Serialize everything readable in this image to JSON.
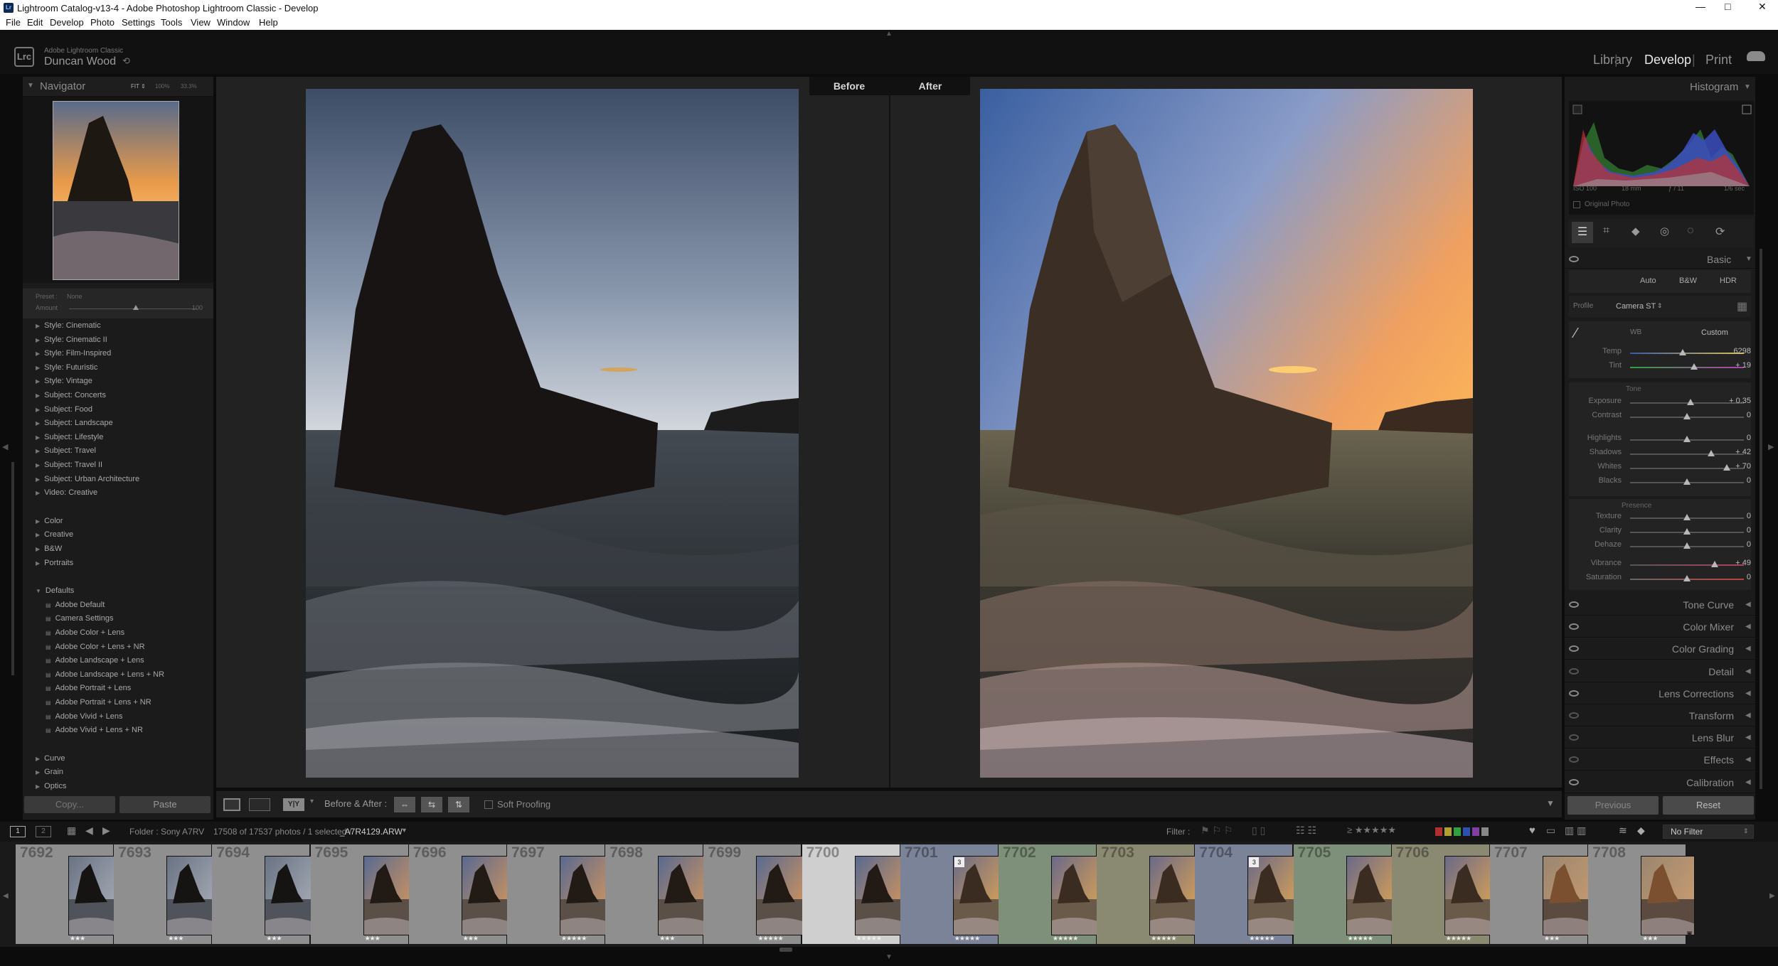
{
  "window": {
    "title": "Lightroom Catalog-v13-4 - Adobe Photoshop Lightroom Classic - Develop",
    "minimize": "—",
    "maximize": "□",
    "close": "✕"
  },
  "menu": [
    "File",
    "Edit",
    "Develop",
    "Photo",
    "Settings",
    "Tools",
    "View",
    "Window",
    "Help"
  ],
  "identity": {
    "app_name": "Adobe Lightroom Classic",
    "user": "Duncan Wood",
    "badge": "Lrc"
  },
  "modules": [
    "Library",
    "Develop",
    "Print"
  ],
  "navigator": {
    "title": "Navigator",
    "zoom_options": [
      "FIT ⇕",
      "100%",
      "33.3%"
    ]
  },
  "presets": {
    "preset_label": "Preset :",
    "preset_value": "None",
    "amount_label": "Amount",
    "amount_value": "100",
    "amount_fraction": 0.52,
    "groups": [
      "Style: Cinematic",
      "Style: Cinematic II",
      "Style: Film-Inspired",
      "Style: Futuristic",
      "Style: Vintage",
      "Subject: Concerts",
      "Subject: Food",
      "Subject: Landscape",
      "Subject: Lifestyle",
      "Subject: Travel",
      "Subject: Travel II",
      "Subject: Urban Architecture",
      "Video: Creative"
    ],
    "groups2": [
      "Color",
      "Creative",
      "B&W",
      "Portraits"
    ],
    "defaults_label": "Defaults",
    "defaults": [
      "Adobe Default",
      "Camera Settings",
      "Adobe Color + Lens",
      "Adobe Color + Lens + NR",
      "Adobe Landscape + Lens",
      "Adobe Landscape + Lens + NR",
      "Adobe Portrait + Lens",
      "Adobe Portrait + Lens + NR",
      "Adobe Vivid + Lens",
      "Adobe Vivid + Lens + NR"
    ],
    "groups3": [
      "Curve",
      "Grain",
      "Optics"
    ]
  },
  "left_buttons": {
    "copy": "Copy...",
    "paste": "Paste"
  },
  "compare": {
    "before_label": "Before",
    "after_label": "After"
  },
  "toolbar": {
    "before_after_label": "Before & After :",
    "soft_proofing": "Soft Proofing",
    "yy": "Y|Y"
  },
  "histogram": {
    "title": "Histogram",
    "iso": "ISO 100",
    "focal": "18 mm",
    "aperture": "ƒ / 11",
    "shutter": "1/6 sec",
    "original_photo": "Original Photo"
  },
  "basic": {
    "title": "Basic",
    "treatments": [
      "Auto",
      "B&W",
      "HDR"
    ],
    "profile_label": "Profile",
    "profile_value": "Camera ST",
    "wb_label": "WB",
    "wb_value": "Custom",
    "tone_label": "Tone",
    "presence_label": "Presence",
    "sliders": [
      {
        "label": "Temp",
        "value": "6298",
        "pos": 0.46,
        "group": "wb"
      },
      {
        "label": "Tint",
        "value": "+ 19",
        "pos": 0.56,
        "group": "wb"
      },
      {
        "label": "Exposure",
        "value": "+ 0.35",
        "pos": 0.53,
        "group": "tone"
      },
      {
        "label": "Contrast",
        "value": "0",
        "pos": 0.5,
        "group": "tone"
      },
      {
        "label": "Highlights",
        "value": "0",
        "pos": 0.5,
        "group": "tone2"
      },
      {
        "label": "Shadows",
        "value": "+ 42",
        "pos": 0.71,
        "group": "tone2"
      },
      {
        "label": "Whites",
        "value": "+ 70",
        "pos": 0.85,
        "group": "tone2"
      },
      {
        "label": "Blacks",
        "value": "0",
        "pos": 0.5,
        "group": "tone2"
      },
      {
        "label": "Texture",
        "value": "0",
        "pos": 0.5,
        "group": "presence"
      },
      {
        "label": "Clarity",
        "value": "0",
        "pos": 0.5,
        "group": "presence"
      },
      {
        "label": "Dehaze",
        "value": "0",
        "pos": 0.5,
        "group": "presence"
      },
      {
        "label": "Vibrance",
        "value": "+ 49",
        "pos": 0.745,
        "group": "presence2"
      },
      {
        "label": "Saturation",
        "value": "0",
        "pos": 0.5,
        "group": "presence2"
      }
    ]
  },
  "right_sections": [
    "Tone Curve",
    "Color Mixer",
    "Color Grading",
    "Detail",
    "Lens Corrections",
    "Transform",
    "Lens Blur",
    "Effects",
    "Calibration"
  ],
  "right_buttons": {
    "previous": "Previous",
    "reset": "Reset"
  },
  "filmstrip_bar": {
    "folder": "Folder : Sony A7RV",
    "count": "17508 of 17537 photos / 1 selected /",
    "filename": "_A7R4129.ARW",
    "filter_label": "Filter :",
    "no_filter": "No Filter",
    "view_nums": [
      "1",
      "2"
    ]
  },
  "filmstrip": [
    {
      "num": "7692",
      "stars": "★★★",
      "tone": "dark",
      "bg": "#8f8f8f"
    },
    {
      "num": "7693",
      "stars": "★★★",
      "tone": "dark",
      "bg": "#8f8f8f"
    },
    {
      "num": "7694",
      "stars": "★★★",
      "tone": "dark",
      "bg": "#8f8f8f"
    },
    {
      "num": "7695",
      "stars": "★★★",
      "tone": "warm",
      "bg": "#8f8f8f"
    },
    {
      "num": "7696",
      "stars": "★★★",
      "tone": "warm",
      "bg": "#8f8f8f"
    },
    {
      "num": "7697",
      "stars": "★★★★★",
      "tone": "warm",
      "bg": "#8f8f8f"
    },
    {
      "num": "7698",
      "stars": "★★★",
      "tone": "warm",
      "bg": "#8f8f8f"
    },
    {
      "num": "7699",
      "stars": "★★★★★",
      "tone": "warm",
      "bg": "#8f8f8f"
    },
    {
      "num": "7700",
      "stars": "★★★★★",
      "tone": "warm",
      "bg": "#cfcfcf"
    },
    {
      "num": "7701",
      "stars": "★★★★★",
      "tone": "gold",
      "bg": "#7b8398",
      "badge": "3"
    },
    {
      "num": "7702",
      "stars": "★★★★★",
      "tone": "gold",
      "bg": "#7e8f7a"
    },
    {
      "num": "7703",
      "stars": "★★★★★",
      "tone": "gold",
      "bg": "#8a8a72"
    },
    {
      "num": "7704",
      "stars": "★★★★★",
      "tone": "gold",
      "bg": "#7b8398",
      "badge": "3"
    },
    {
      "num": "7705",
      "stars": "★★★★★",
      "tone": "gold",
      "bg": "#7e8f7a"
    },
    {
      "num": "7706",
      "stars": "★★★★★",
      "tone": "gold",
      "bg": "#8a8a72"
    },
    {
      "num": "7707",
      "stars": "★★★",
      "tone": "rock",
      "bg": "#8f8f8f"
    },
    {
      "num": "7708",
      "stars": "★★★",
      "tone": "rock",
      "bg": "#8f8f8f"
    }
  ],
  "colors": {
    "accent": "#d9d9d9",
    "panel": "#1e1e1e",
    "background": "#0c0c0c"
  }
}
